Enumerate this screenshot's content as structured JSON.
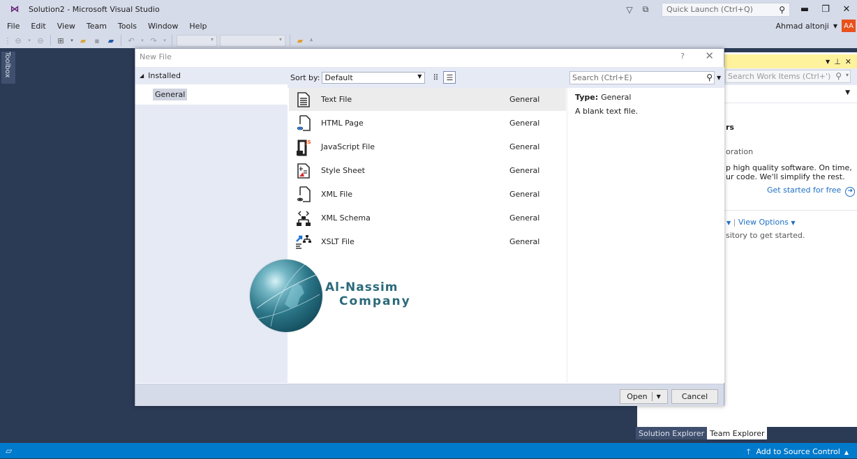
{
  "window": {
    "title": "Solution2 - Microsoft Visual Studio",
    "quick_launch_placeholder": "Quick Launch (Ctrl+Q)",
    "minimize": "▬",
    "restore": "❐",
    "close": "✕"
  },
  "menu": [
    "File",
    "Edit",
    "View",
    "Team",
    "Tools",
    "Window",
    "Help"
  ],
  "account": {
    "name": "Ahmad altonji",
    "initials": "AA",
    "color": "#e8511a"
  },
  "toolbox": {
    "label": "Toolbox"
  },
  "dialog": {
    "title": "New File",
    "help": "?",
    "close": "✕",
    "tree": {
      "root": "Installed",
      "selected": "General"
    },
    "sort": {
      "label": "Sort by:",
      "value": "Default"
    },
    "search_placeholder": "Search (Ctrl+E)",
    "templates": [
      {
        "name": "Text File",
        "category": "General",
        "icon": "text-file-icon"
      },
      {
        "name": "HTML Page",
        "category": "General",
        "icon": "html-page-icon"
      },
      {
        "name": "JavaScript File",
        "category": "General",
        "icon": "javascript-file-icon"
      },
      {
        "name": "Style Sheet",
        "category": "General",
        "icon": "style-sheet-icon"
      },
      {
        "name": "XML File",
        "category": "General",
        "icon": "xml-file-icon"
      },
      {
        "name": "XML Schema",
        "category": "General",
        "icon": "xml-schema-icon"
      },
      {
        "name": "XSLT File",
        "category": "General",
        "icon": "xslt-file-icon"
      }
    ],
    "detail": {
      "type_label": "Type:",
      "type_value": "General",
      "description": "A blank text file."
    },
    "buttons": {
      "open": "Open",
      "cancel": "Cancel"
    }
  },
  "watermark": {
    "line1": "Al-Nassim",
    "line2": "Company"
  },
  "team_explorer": {
    "search_placeholder": "Search Work Items (Ctrl+')",
    "heading_fragment": "rs",
    "sub_fragment": "oration",
    "body_line1": "p high quality software. On time,",
    "body_line2": "ur code. We'll simplify the rest.",
    "get_started": "Get started for free",
    "view_options": "View Options",
    "repo_hint": "sitory to get started."
  },
  "bottom_tabs": [
    "Solution Explorer",
    "Team Explorer"
  ],
  "statusbar": {
    "source_control": "Add to Source Control"
  }
}
